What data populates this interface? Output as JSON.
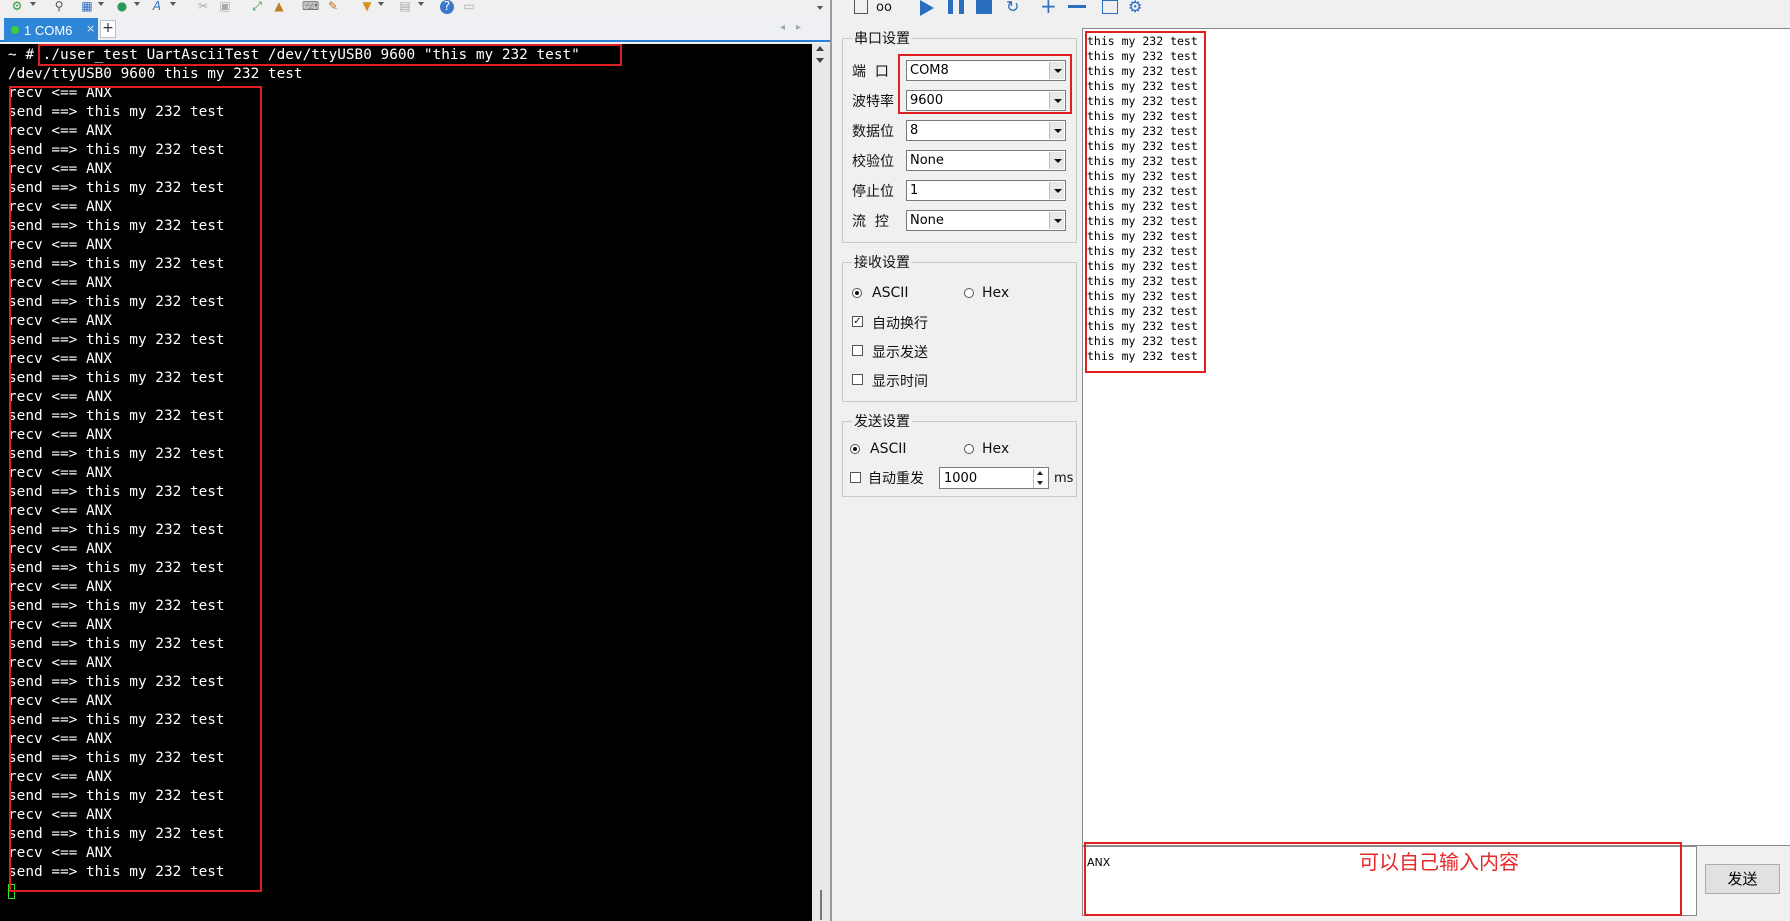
{
  "terminal": {
    "tab": {
      "label": "1 COM6",
      "close": "×"
    },
    "new_tab": "+",
    "nav_prev": "◂",
    "nav_next": "▸",
    "lines": [
      "~ # ./user_test UartAsciiTest /dev/ttyUSB0 9600 \"this my 232 test\"",
      "/dev/ttyUSB0 9600 this my 232 test",
      "recv <== ANX",
      "send ==> this my 232 test",
      "recv <== ANX",
      "send ==> this my 232 test",
      "recv <== ANX",
      "send ==> this my 232 test",
      "recv <== ANX",
      "send ==> this my 232 test",
      "recv <== ANX",
      "send ==> this my 232 test",
      "recv <== ANX",
      "send ==> this my 232 test",
      "recv <== ANX",
      "send ==> this my 232 test",
      "recv <== ANX",
      "send ==> this my 232 test",
      "recv <== ANX",
      "send ==> this my 232 test",
      "recv <== ANX",
      "send ==> this my 232 test",
      "recv <== ANX",
      "send ==> this my 232 test",
      "recv <== ANX",
      "send ==> this my 232 test",
      "recv <== ANX",
      "send ==> this my 232 test",
      "recv <== ANX",
      "send ==> this my 232 test",
      "recv <== ANX",
      "send ==> this my 232 test",
      "recv <== ANX",
      "send ==> this my 232 test",
      "recv <== ANX",
      "send ==> this my 232 test",
      "recv <== ANX",
      "send ==> this my 232 test",
      "recv <== ANX",
      "send ==> this my 232 test",
      "recv <== ANX",
      "send ==> this my 232 test",
      "recv <== ANX",
      "send ==> this my 232 test"
    ]
  },
  "serial_settings": {
    "title": "串口设置",
    "port": {
      "label": "端  口",
      "value": "COM8"
    },
    "baud": {
      "label": "波特率",
      "value": "9600"
    },
    "databits": {
      "label": "数据位",
      "value": "8"
    },
    "parity": {
      "label": "校验位",
      "value": "None"
    },
    "stopbits": {
      "label": "停止位",
      "value": "1"
    },
    "flow": {
      "label": "流  控",
      "value": "None"
    }
  },
  "receive_settings": {
    "title": "接收设置",
    "ascii": "ASCII",
    "hex": "Hex",
    "auto_newline": "自动换行",
    "show_send": "显示发送",
    "show_time": "显示时间"
  },
  "send_settings": {
    "title": "发送设置",
    "ascii": "ASCII",
    "hex": "Hex",
    "auto_resend": "自动重发",
    "interval": "1000",
    "unit": "ms"
  },
  "receive_lines": [
    "this my 232 test",
    "this my 232 test",
    "this my 232 test",
    "this my 232 test",
    "this my 232 test",
    "this my 232 test",
    "this my 232 test",
    "this my 232 test",
    "this my 232 test",
    "this my 232 test",
    "this my 232 test",
    "this my 232 test",
    "this my 232 test",
    "this my 232 test",
    "this my 232 test",
    "this my 232 test",
    "this my 232 test",
    "this my 232 test",
    "this my 232 test",
    "this my 232 test",
    "this my 232 test",
    "this my 232 test"
  ],
  "send_box": {
    "value": "ANX",
    "note": "可以自己输入内容"
  },
  "send_button": "发送",
  "colors": {
    "accent": "#2f86d6",
    "highlight": "#e02020",
    "terminal_bg": "#000000"
  }
}
